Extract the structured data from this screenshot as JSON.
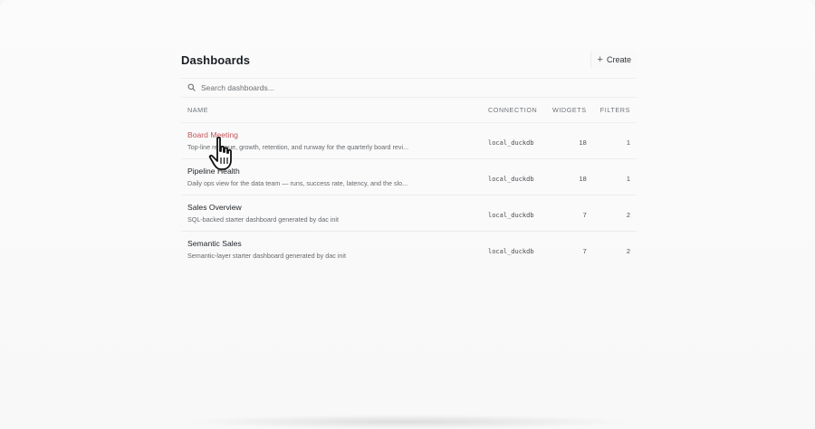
{
  "header": {
    "title": "Dashboards",
    "create_label": "Create",
    "create_icon": "plus-icon"
  },
  "search": {
    "placeholder": "Search dashboards..."
  },
  "table": {
    "columns": {
      "name": "NAME",
      "connection": "CONNECTION",
      "widgets": "WIDGETS",
      "filters": "FILTERS"
    },
    "rows": [
      {
        "name": "Board Meeting",
        "description": "Top-line revenue, growth, retention, and runway for the quarterly board revi...",
        "connection": "local_duckdb",
        "widgets": "18",
        "filters": "1"
      },
      {
        "name": "Pipeline Health",
        "description": "Daily ops view for the data team — runs, success rate, latency, and the slo...",
        "connection": "local_duckdb",
        "widgets": "18",
        "filters": "1"
      },
      {
        "name": "Sales Overview",
        "description": "SQL-backed starter dashboard generated by dac init",
        "connection": "local_duckdb",
        "widgets": "7",
        "filters": "2"
      },
      {
        "name": "Semantic Sales",
        "description": "Semantic-layer starter dashboard generated by dac init",
        "connection": "local_duckdb",
        "widgets": "7",
        "filters": "2"
      }
    ]
  },
  "colors": {
    "hover_link": "#c2545a",
    "text": "#1f2328",
    "muted": "#66696e"
  }
}
